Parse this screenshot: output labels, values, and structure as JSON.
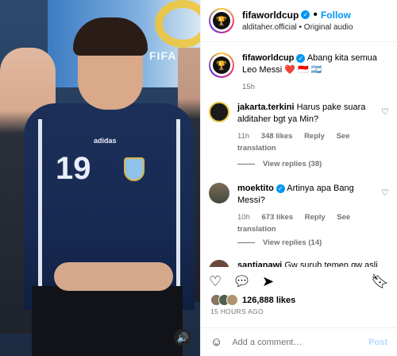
{
  "post": {
    "username": "fifaworldcup",
    "follow_label": "Follow",
    "audio_text": "alditaher.official • Original audio",
    "audio_icon": "speaker-icon",
    "jersey_number": "19",
    "brand": "adidas"
  },
  "caption": {
    "username": "fifaworldcup",
    "text": "Abang kita semua Leo Messi ❤️ 🇮🇩 🇦🇷",
    "time": "15h"
  },
  "comments": [
    {
      "username": "jakarta.terkini",
      "text": "Harus pake suara alditaher bgt ya Min?",
      "time": "11h",
      "likes": "348 likes",
      "reply": "Reply",
      "translate": "See translation",
      "view_replies": "View replies (38)"
    },
    {
      "username": "moektito",
      "text": "Artinya apa Bang Messi?",
      "time": "10h",
      "likes": "673 likes",
      "reply": "Reply",
      "translate": "See translation",
      "view_replies": "View replies (14)"
    },
    {
      "username": "santianawi",
      "text": "Gw suruh temen gw asli"
    }
  ],
  "footer": {
    "likes": "126,888 likes",
    "timestamp": "15 HOURS AGO",
    "comment_placeholder": "Add a comment…",
    "post_label": "Post"
  },
  "colors": {
    "accent": "#0095f6",
    "muted": "#737373"
  }
}
